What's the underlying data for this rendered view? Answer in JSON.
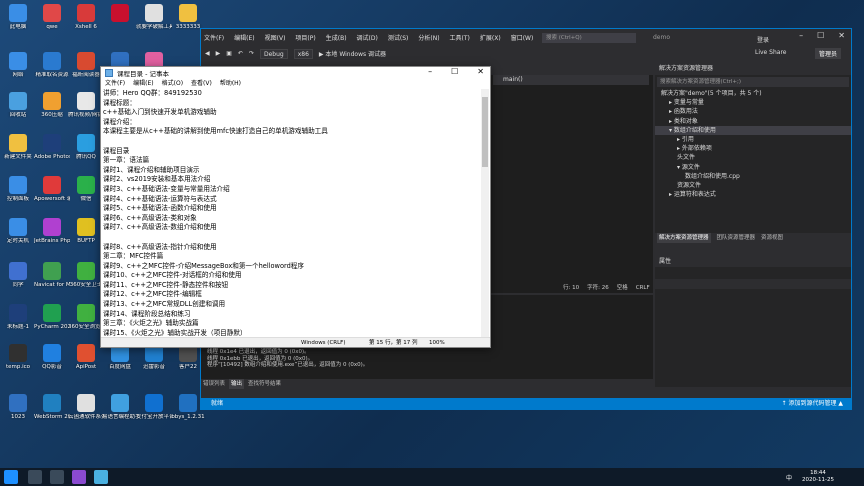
{
  "desktop": {
    "icons": [
      {
        "label": "此电脑",
        "color": "#3a8ee6"
      },
      {
        "label": "qwe",
        "color": "#e04848"
      },
      {
        "label": "Xshell 6",
        "color": "#d83a3a"
      },
      {
        "label": "",
        "color": "#c8102e"
      },
      {
        "label": "就要学破解工具包",
        "color": "#e0e0e0"
      },
      {
        "label": "3333333",
        "color": "#f0c040"
      },
      {
        "label": "网络",
        "color": "#3a8ee6"
      },
      {
        "label": "精准取名资源",
        "color": "#2a7ad0"
      },
      {
        "label": "福昕阅读器",
        "color": "#d84a30"
      },
      {
        "label": "",
        "color": "#3070c0"
      },
      {
        "label": "",
        "color": "#e060a0"
      },
      {
        "label": "回收站",
        "color": "#4aa0e0"
      },
      {
        "label": "360压缩",
        "color": "#f0a030"
      },
      {
        "label": "腾讯视频/网银行管理工具",
        "color": "#e8e8e8"
      },
      {
        "label": "新建文件夹",
        "color": "#f0c040"
      },
      {
        "label": "Adobe Photosh...",
        "color": "#1e3f7a"
      },
      {
        "label": "腾讯QQ",
        "color": "#2a9ee0"
      },
      {
        "label": "控制面板",
        "color": "#3a8ee6"
      },
      {
        "label": "Apowersoft 录屏王",
        "color": "#e03a3a"
      },
      {
        "label": "微信",
        "color": "#2ab04a"
      },
      {
        "label": "定时关机",
        "color": "#3a8ee6"
      },
      {
        "label": "JetBrains PhpStor...",
        "color": "#b040d0"
      },
      {
        "label": "BUFTP",
        "color": "#e0c020"
      },
      {
        "label": "同学",
        "color": "#4070d0"
      },
      {
        "label": "Navicat for MySQL",
        "color": "#40a050"
      },
      {
        "label": "360安全卫士",
        "color": "#40b040"
      },
      {
        "label": "未标题-1",
        "color": "#1e3f7a"
      },
      {
        "label": "PyCharm 2020.2 x64",
        "color": "#20a050"
      },
      {
        "label": "360安全浏览器",
        "color": "#40b040"
      },
      {
        "label": "temp.ico",
        "color": "#303030"
      },
      {
        "label": "QQ影音",
        "color": "#2080e0"
      },
      {
        "label": "ApiPost",
        "color": "#e05030"
      },
      {
        "label": "百度网盘",
        "color": "#3090e0"
      },
      {
        "label": "迅雷影音",
        "color": "#2080d0"
      },
      {
        "label": "客户22",
        "color": "#505050"
      },
      {
        "label": "1023",
        "color": "#3070c0"
      },
      {
        "label": "WebStorm 2020.2 x64",
        "color": "#2080c0"
      },
      {
        "label": "云函通软件系列——仔会...",
        "color": "#e0e0e0"
      },
      {
        "label": "易语言编程助手",
        "color": "#40a0e0"
      },
      {
        "label": "支付宝开放平台开发助手",
        "color": "#1070d0"
      },
      {
        "label": "bbys_1.2.31",
        "color": "#2070c0"
      }
    ]
  },
  "vs": {
    "menu": [
      "文件(F)",
      "编辑(E)",
      "视图(V)",
      "项目(P)",
      "生成(B)",
      "调试(D)",
      "测试(S)",
      "分析(N)",
      "工具(T)",
      "扩展(X)",
      "窗口(W)",
      "帮助(H)"
    ],
    "search_placeholder": "搜索 (Ctrl+Q)",
    "project_name": "demo",
    "login": "登录",
    "config": "Debug",
    "platform": "x86",
    "run_label": "▶ 本地 Windows 调试器",
    "live_share": "Live Share",
    "admin": "管理员",
    "editor_scope": "main()",
    "editor_status": [
      "行: 10",
      "字符: 26",
      "空格",
      "CRLF"
    ],
    "solution_header": "解决方案资源管理器",
    "solution_search": "搜索解决方案资源管理器(Ctrl+;)",
    "tree": [
      {
        "text": "解决方案\"demo\"(5 个项目，共 5 个)",
        "indent": 0,
        "sel": false
      },
      {
        "text": "▸ 变量与常量",
        "indent": 1,
        "sel": false
      },
      {
        "text": "▸ 函数用法",
        "indent": 1,
        "sel": false
      },
      {
        "text": "▸ 类和对象",
        "indent": 1,
        "sel": false
      },
      {
        "text": "▾ 数组介绍和使用",
        "indent": 1,
        "sel": true
      },
      {
        "text": "▸ 引用",
        "indent": 2,
        "sel": false
      },
      {
        "text": "▸ 外部依赖项",
        "indent": 2,
        "sel": false
      },
      {
        "text": "头文件",
        "indent": 2,
        "sel": false
      },
      {
        "text": "▾ 源文件",
        "indent": 2,
        "sel": false
      },
      {
        "text": "数组介绍和使用.cpp",
        "indent": 3,
        "sel": false
      },
      {
        "text": "资源文件",
        "indent": 2,
        "sel": false
      },
      {
        "text": "▸ 运算符和表达式",
        "indent": 1,
        "sel": false
      }
    ],
    "sol_tabs": [
      "解决方案资源管理器",
      "团队资源管理器",
      "资源视图"
    ],
    "props_header": "属性",
    "output_lines": [
      "线程 0x1e4 已退出，返回值为 0 (0x0)。",
      "线程 0x1ebb 已退出，返回值为 0 (0x0)。",
      "程序“[10492] 数组介绍和使用.exe”已退出，返回值为 0 (0x0)。"
    ],
    "out_tabs": [
      "错误列表",
      "输出",
      "查找符号结果"
    ],
    "status_left": "就绪",
    "status_right": "↑ 添加到源代码管理 ▲"
  },
  "notepad": {
    "title": "课程目录 - 记事本",
    "menu": [
      "文件(F)",
      "编辑(E)",
      "格式(O)",
      "查看(V)",
      "帮助(H)"
    ],
    "lines": [
      "讲师：Hero QQ群：849192530",
      "课程标题：",
      "c++基础入门到快速开发单机游戏辅助",
      "课程介绍：",
      "本课程主要是从c++基础的讲解到使用mfc快速打造自己的单机游戏辅助工具",
      "",
      "课程目录",
      "第一章：语法篇",
      "课时1、课程介绍和辅助项目演示",
      "课时2、vs2019安装和基本用法介绍",
      "课时3、c++基础语法-变量与常量用法介绍",
      "课时4、c++基础语法-运算符与表达式",
      "课时5、c++基础语法-函数介绍和使用",
      "课时6、c++高级语法-类和对象",
      "课时7、c++高级语法-数组介绍和使用",
      "",
      "课时8、c++高级语法-指针介绍和使用",
      "第二章：MFC控件篇",
      "课时9、c++之MFC控件-介绍MessageBox和第一个helloword程序",
      "课时10、c++之MFC控件-对话框的介绍和使用",
      "课时11、c++之MFC控件-静态控件和按钮",
      "课时12、c++之MFC控件-编辑框",
      "课时13、c++之MFC常规DLL创建和调用",
      "课时14、课程阶段总结和练习",
      "第三章：《火炬之光》辅助实战篇",
      "课时15、《火炬之光》辅助实战开发（项目静默）"
    ],
    "status_encoding": "Windows (CRLF)",
    "status_pos": "第 15 行，第 17 列",
    "status_zoom": "100%"
  },
  "taskbar": {
    "time": "18:44",
    "date": "2020-11-25",
    "lang": "中"
  }
}
